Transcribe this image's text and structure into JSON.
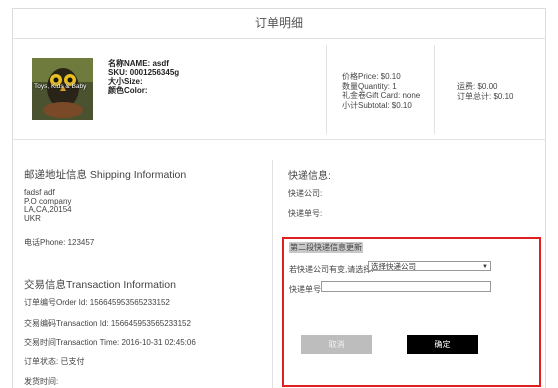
{
  "page": {
    "title": "订单明细"
  },
  "product": {
    "image_caption": "Toys, Kids & Baby",
    "name": "名称NAME:  asdf",
    "sku": "SKU:  0001256345g",
    "size": "大小Size:",
    "color": "颜色Color:"
  },
  "pricing": {
    "price": "价格Price:  $0.10",
    "quantity": "数量Quantity:  1",
    "gift_card": "礼金卷Gift Card:  none",
    "subtotal": "小计Subtotal:  $0.10"
  },
  "totals": {
    "shipping": "运费:  $0.00",
    "total": "订单总计:  $0.10"
  },
  "shipping": {
    "heading": "邮递地址信息 Shipping Information",
    "lines": [
      "fadsf adf",
      "P.O company",
      "LA,CA,20154",
      "UKR"
    ],
    "phone": "电话Phone:  123457"
  },
  "transaction": {
    "heading": "交易信息Transaction Information",
    "order_id": "订单编号Order Id:  156645953565233152",
    "transaction_id": "交易编码Transaction Id:  156645953565233152",
    "transaction_time": "交易时间Transaction Time:  2016-10-31 02:45:06",
    "order_status": "订单状态:  已支付",
    "ship_time": "发货时间:"
  },
  "express": {
    "heading": "快递信息:",
    "company": "快递公司:",
    "tracking": "快递单号:"
  },
  "update_form": {
    "title": "第二段快递信息更新",
    "company_label": "若快递公司有变,请选择:",
    "company_select": "选择快递公司",
    "tracking_label": "快递单号:",
    "tracking_value": "",
    "cancel_label": "取消",
    "confirm_label": "确定"
  },
  "colors": {
    "highlight_border": "#e02020",
    "confirm_bg": "#000000",
    "cancel_bg": "#bdbdbd"
  }
}
